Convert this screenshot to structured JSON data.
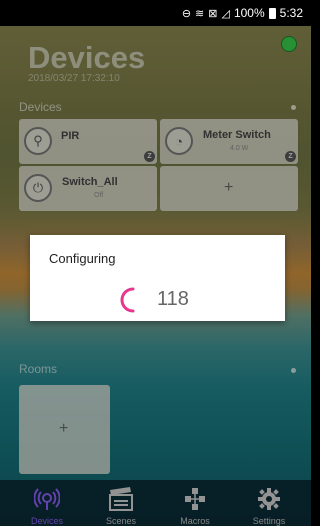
{
  "status_bar": {
    "battery": "100%",
    "time": "5:32"
  },
  "header": {
    "title": "Devices",
    "datetime": "2018/03/27 17:32:10"
  },
  "devices_section": {
    "label": "Devices",
    "tiles": [
      {
        "name": "PIR",
        "value": ""
      },
      {
        "name": "Meter Switch",
        "value": "4.0 W"
      },
      {
        "name": "Switch_All",
        "value": "Off"
      }
    ],
    "add_label": "+",
    "badge_label": "Z"
  },
  "rooms_section": {
    "label": "Rooms",
    "add_label": "+"
  },
  "dialog": {
    "title": "Configuring",
    "count": "118"
  },
  "bottom_nav": {
    "items": [
      {
        "label": "Devices",
        "icon": "devices-icon"
      },
      {
        "label": "Scenes",
        "icon": "clapperboard-icon"
      },
      {
        "label": "Macros",
        "icon": "macros-icon"
      },
      {
        "label": "Settings",
        "icon": "gear-icon"
      }
    ],
    "active_color": "#8a5cf0"
  },
  "colors": {
    "status_online": "#37c84a",
    "spinner": "#e8368f"
  }
}
